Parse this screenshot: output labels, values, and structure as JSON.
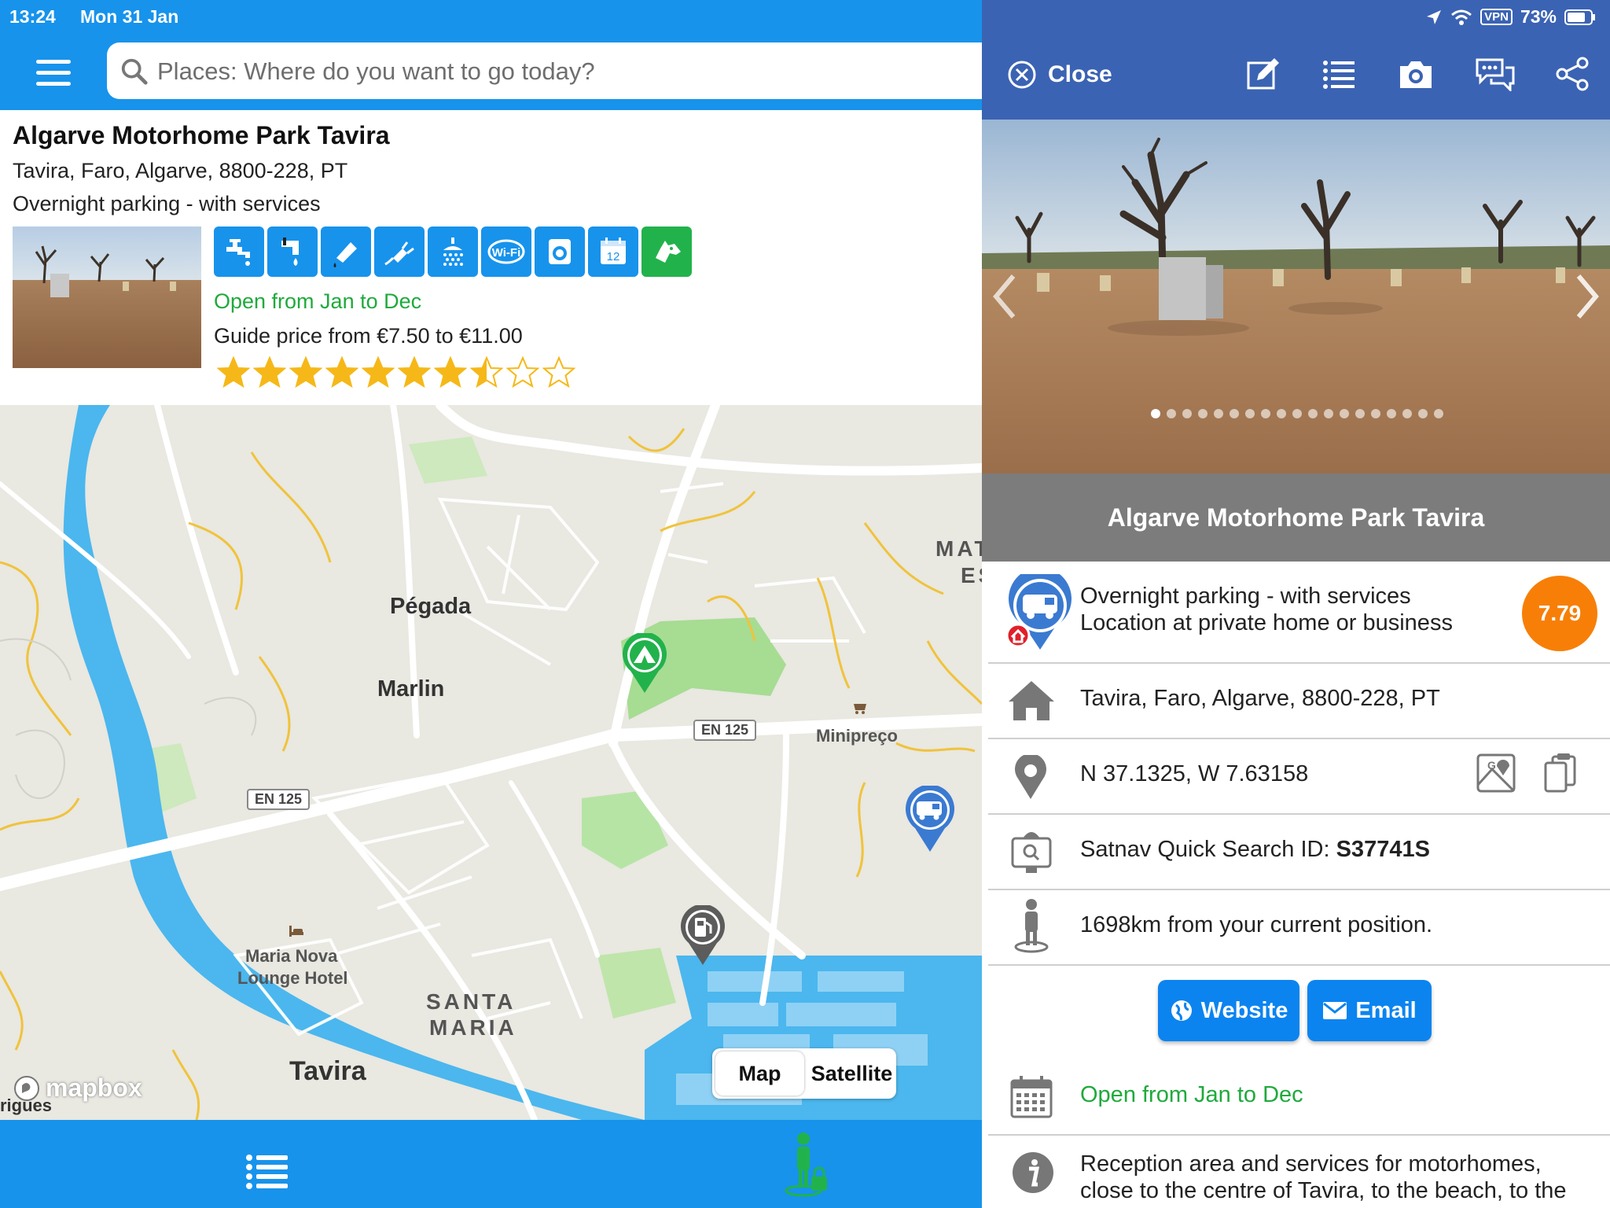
{
  "status": {
    "time": "13:24",
    "date": "Mon 31 Jan",
    "vpn": "VPN",
    "battery": "73%"
  },
  "search": {
    "placeholder": "Places: Where do you want to go today?"
  },
  "card": {
    "title": "Algarve Motorhome Park Tavira",
    "address": "Tavira, Faro, Algarve, 8800-228, PT",
    "type": "Overnight parking - with services",
    "amenities": [
      "water-tap-icon",
      "drinking-water-icon",
      "grey-water-disposal-icon",
      "electric-hookup-icon",
      "shower-icon",
      "wifi-icon",
      "laundry-icon",
      "calendar-12-months-icon",
      "dogs-allowed-icon"
    ],
    "calendar_number": "12",
    "wifi_text": "Wi-Fi",
    "open": "Open from Jan to Dec",
    "price": "Guide price from €7.50 to €11.00",
    "rating_stars": 7.5,
    "rating_max": 10
  },
  "map": {
    "labels": {
      "pegada": "Pégada",
      "marlin": "Marlin",
      "minipreco": "Minipreço",
      "hotel1": "Maria Nova",
      "hotel2": "Lounge Hotel",
      "santa": "SANTA",
      "maria": "MARIA",
      "tavira": "Tavira",
      "mat1": "MAT",
      "mat2": "ES",
      "rigues": "rigues"
    },
    "roads": {
      "en125a": "EN 125",
      "en125b": "EN 125"
    },
    "toggle": {
      "map": "Map",
      "satellite": "Satellite",
      "selected": "Map"
    },
    "attribution": "mapbox"
  },
  "panel": {
    "close": "Close",
    "title": "Algarve Motorhome Park Tavira",
    "gallery_dots": 19,
    "gallery_current": 1,
    "type_line1": "Overnight parking - with services",
    "type_line2": "Location at private home or business",
    "score": "7.79",
    "address": "Tavira, Faro, Algarve, 8800-228, PT",
    "coords": "N 37.1325, W 7.63158",
    "satnav_label": "Satnav Quick Search ID: ",
    "satnav_id": "S37741S",
    "distance": "1698km from your current position.",
    "website": "Website",
    "email": "Email",
    "open": "Open from Jan to Dec",
    "description_line1": "Reception area and services for motorhomes,",
    "description_line2": "close to the centre of Tavira, to the beach, to the"
  },
  "colors": {
    "primary": "#1793ec",
    "panel_header": "#3b63b3",
    "open_green": "#1faa3c",
    "score_orange": "#f77f07",
    "star": "#f6b818"
  }
}
